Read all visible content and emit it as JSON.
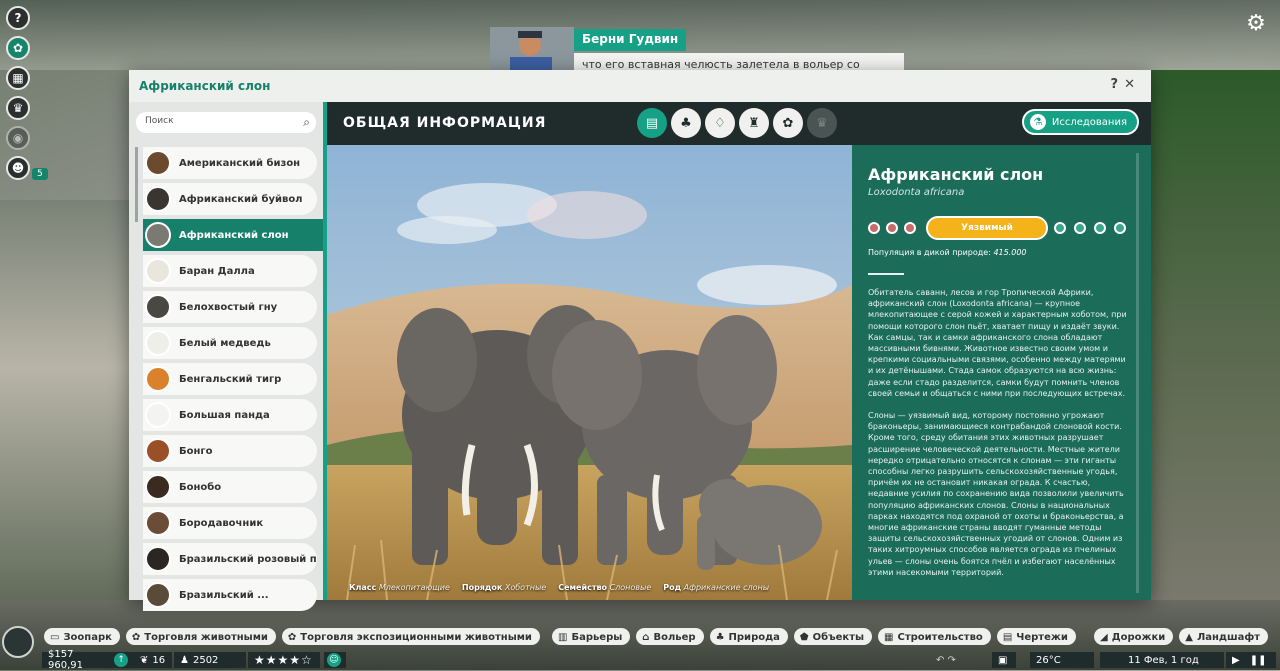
{
  "hud": {
    "help": "?",
    "notif_count": "5"
  },
  "notification": {
    "name": "Берни Гудвин",
    "text": "что его вставная челюсть залетела в вольер со львами."
  },
  "window": {
    "title": "Африканский слон",
    "help": "?",
    "close": "✕"
  },
  "search": {
    "placeholder": "Поиск"
  },
  "animals": [
    {
      "label": "Американский бизон",
      "color": "#6b4a2e"
    },
    {
      "label": "Африканский буйвол",
      "color": "#3a3530"
    },
    {
      "label": "Африканский слон",
      "color": "#7a7a72"
    },
    {
      "label": "Баран Далла",
      "color": "#e9e6dd"
    },
    {
      "label": "Белохвостый гну",
      "color": "#4a4843"
    },
    {
      "label": "Белый медведь",
      "color": "#efefe9"
    },
    {
      "label": "Бенгальский тигр",
      "color": "#d9822b"
    },
    {
      "label": "Большая панда",
      "color": "#f3f3f3"
    },
    {
      "label": "Бонго",
      "color": "#9b4f26"
    },
    {
      "label": "Бонобо",
      "color": "#3b2a1f"
    },
    {
      "label": "Бородавочник",
      "color": "#6a4c37"
    },
    {
      "label": "Бразильский розовый п...",
      "color": "#2b2623"
    },
    {
      "label": "Бразильский ...",
      "color": "#5a4a3a"
    }
  ],
  "content": {
    "header": "ОБЩАЯ ИНФОРМАЦИЯ",
    "research": "Исследования",
    "caption": {
      "class_k": "Класс",
      "class_v": "Млекопитающие",
      "order_k": "Порядок",
      "order_v": "Хоботные",
      "family_k": "Семейство",
      "family_v": "Слоновые",
      "genus_k": "Род",
      "genus_v": "Африканские слоны"
    }
  },
  "info": {
    "name": "Африканский слон",
    "latin": "Loxodonta africana",
    "status": "Уязвимый",
    "pop_label": "Популяция в дикой природе:",
    "pop_value": "415.000",
    "desc1": "Обитатель саванн, лесов и гор Тропической Африки, африканский слон (Loxodonta africana) — крупное млекопитающее с серой кожей и характерным хоботом, при помощи которого слон пьёт, хватает пищу и издаёт звуки. Как самцы, так и самки африканского слона обладают массивными бивнями. Животное известно своим умом и крепкими социальными связями, особенно между матерями и их детёнышами. Стада самок образуются на всю жизнь: даже если стадо разделится, самки будут помнить членов своей семьи и общаться с ними при последующих встречах.",
    "desc2": "Слоны — уязвимый вид, которому постоянно угрожают браконьеры, занимающиеся контрабандой слоновой кости. Кроме того, среду обитания этих животных разрушает расширение человеческой деятельности. Местные жители нередко отрицательно относятся к слонам — эти гиганты способны легко разрушить сельскохозяйственные угодья, причём их не остановит никакая ограда. К счастью, недавние усилия по сохранению вида позволили увеличить популяцию африканских слонов. Слоны в национальных парках находятся под охраной от охоты и браконьерства, а многие африканские страны вводят гуманные методы защиты сельскохозяйственных угодий от слонов. Одним из таких хитроумных способов является ограда из пчелиных ульев — слоны очень боятся пчёл и избегают населённых этими насекомыми территорий."
  },
  "bottom": {
    "left_buttons": [
      "Зоопарк",
      "Торговля животными",
      "Торговля экспозиционными животными"
    ],
    "mid_buttons": [
      "Барьеры",
      "Вольер",
      "Природа",
      "Объекты",
      "Строительство",
      "Чертежи"
    ],
    "right_buttons": [
      "Дорожки",
      "Ландшафт"
    ],
    "money": "$157 960,91",
    "conservation": "16",
    "guests": "2502",
    "stars": "★★★★☆",
    "temp": "26°C",
    "date": "11 Фев, 1 год"
  }
}
